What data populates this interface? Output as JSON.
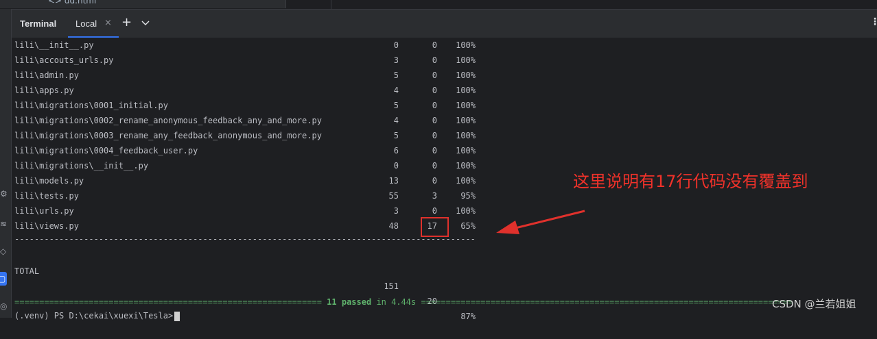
{
  "top": {
    "file_tab_label": "<> dd.html"
  },
  "panel": {
    "title": "Terminal",
    "tab_label": "Local",
    "close_icon": "×",
    "add_icon": "+",
    "more_icon": "⋮"
  },
  "coverage": {
    "rows": [
      {
        "name": "lili\\__init__.py",
        "stmts": "0",
        "miss": "0",
        "cover": "100%"
      },
      {
        "name": "lili\\accouts_urls.py",
        "stmts": "3",
        "miss": "0",
        "cover": "100%"
      },
      {
        "name": "lili\\admin.py",
        "stmts": "5",
        "miss": "0",
        "cover": "100%"
      },
      {
        "name": "lili\\apps.py",
        "stmts": "4",
        "miss": "0",
        "cover": "100%"
      },
      {
        "name": "lili\\migrations\\0001_initial.py",
        "stmts": "5",
        "miss": "0",
        "cover": "100%"
      },
      {
        "name": "lili\\migrations\\0002_rename_anonymous_feedback_any_and_more.py",
        "stmts": "4",
        "miss": "0",
        "cover": "100%"
      },
      {
        "name": "lili\\migrations\\0003_rename_any_feedback_anonymous_and_more.py",
        "stmts": "5",
        "miss": "0",
        "cover": "100%"
      },
      {
        "name": "lili\\migrations\\0004_feedback_user.py",
        "stmts": "6",
        "miss": "0",
        "cover": "100%"
      },
      {
        "name": "lili\\migrations\\__init__.py",
        "stmts": "0",
        "miss": "0",
        "cover": "100%"
      },
      {
        "name": "lili\\models.py",
        "stmts": "13",
        "miss": "0",
        "cover": "100%"
      },
      {
        "name": "lili\\tests.py",
        "stmts": "55",
        "miss": "3",
        "cover": "95%"
      },
      {
        "name": "lili\\urls.py",
        "stmts": "3",
        "miss": "0",
        "cover": "100%"
      },
      {
        "name": "lili\\views.py",
        "stmts": "48",
        "miss": "17",
        "cover": "65%"
      }
    ],
    "separator": "------------------------------------------------------------------------------------------------",
    "total": {
      "name": "TOTAL",
      "stmts": "151",
      "miss": "20",
      "cover": "87%"
    }
  },
  "result": {
    "left_rule": "==============================================================",
    "passed": "11 passed",
    "timing": "in 4.44s",
    "right_rule": "==========================================================================="
  },
  "prompt": {
    "text": "(.venv) PS D:\\cekai\\xuexi\\Tesla>"
  },
  "annotation": {
    "text": "这里说明有17行代码没有覆盖到",
    "color": "#f0322a"
  },
  "watermark": {
    "text": "CSDN @兰若姐姐"
  },
  "colors": {
    "background": "#1e1f22",
    "accent": "#3574f0",
    "pass_green": "#5fb26c"
  }
}
